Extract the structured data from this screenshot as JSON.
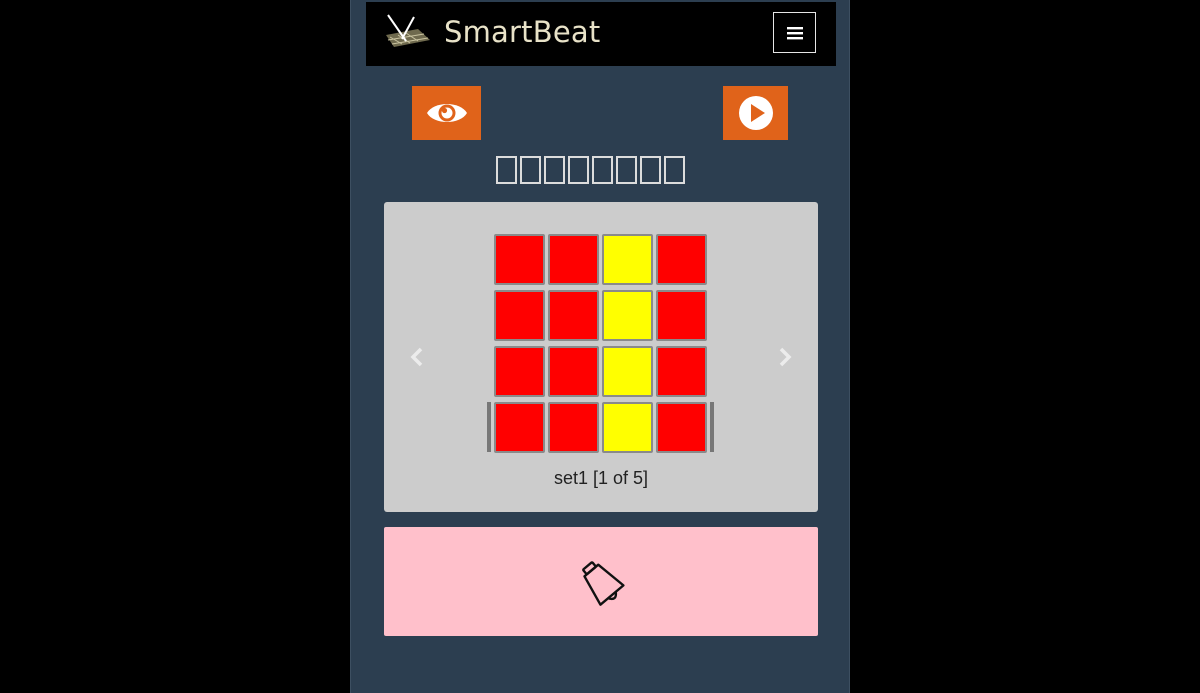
{
  "brand": {
    "name": "SmartBeat"
  },
  "colors": {
    "page_bg": "#000000",
    "app_bg": "#2c3e50",
    "accent": "#e0631a",
    "panel_bg": "#cccccc",
    "pad_bg": "#ffc0cb",
    "cell_off": "#ff0000",
    "cell_on": "#ffff00"
  },
  "toolbar": {
    "view_icon": "eye-icon",
    "play_icon": "play-icon",
    "menu_icon": "hamburger-icon"
  },
  "step_boxes": [
    "",
    "",
    "",
    "",
    "",
    "",
    "",
    ""
  ],
  "grid": {
    "rows": [
      [
        "off",
        "off",
        "on",
        "off"
      ],
      [
        "off",
        "off",
        "on",
        "off"
      ],
      [
        "off",
        "off",
        "on",
        "off"
      ],
      [
        "off",
        "off",
        "on",
        "off"
      ]
    ],
    "caption": "set1 [1 of 5]"
  },
  "sound_pad": {
    "icon": "cowbell-icon"
  }
}
